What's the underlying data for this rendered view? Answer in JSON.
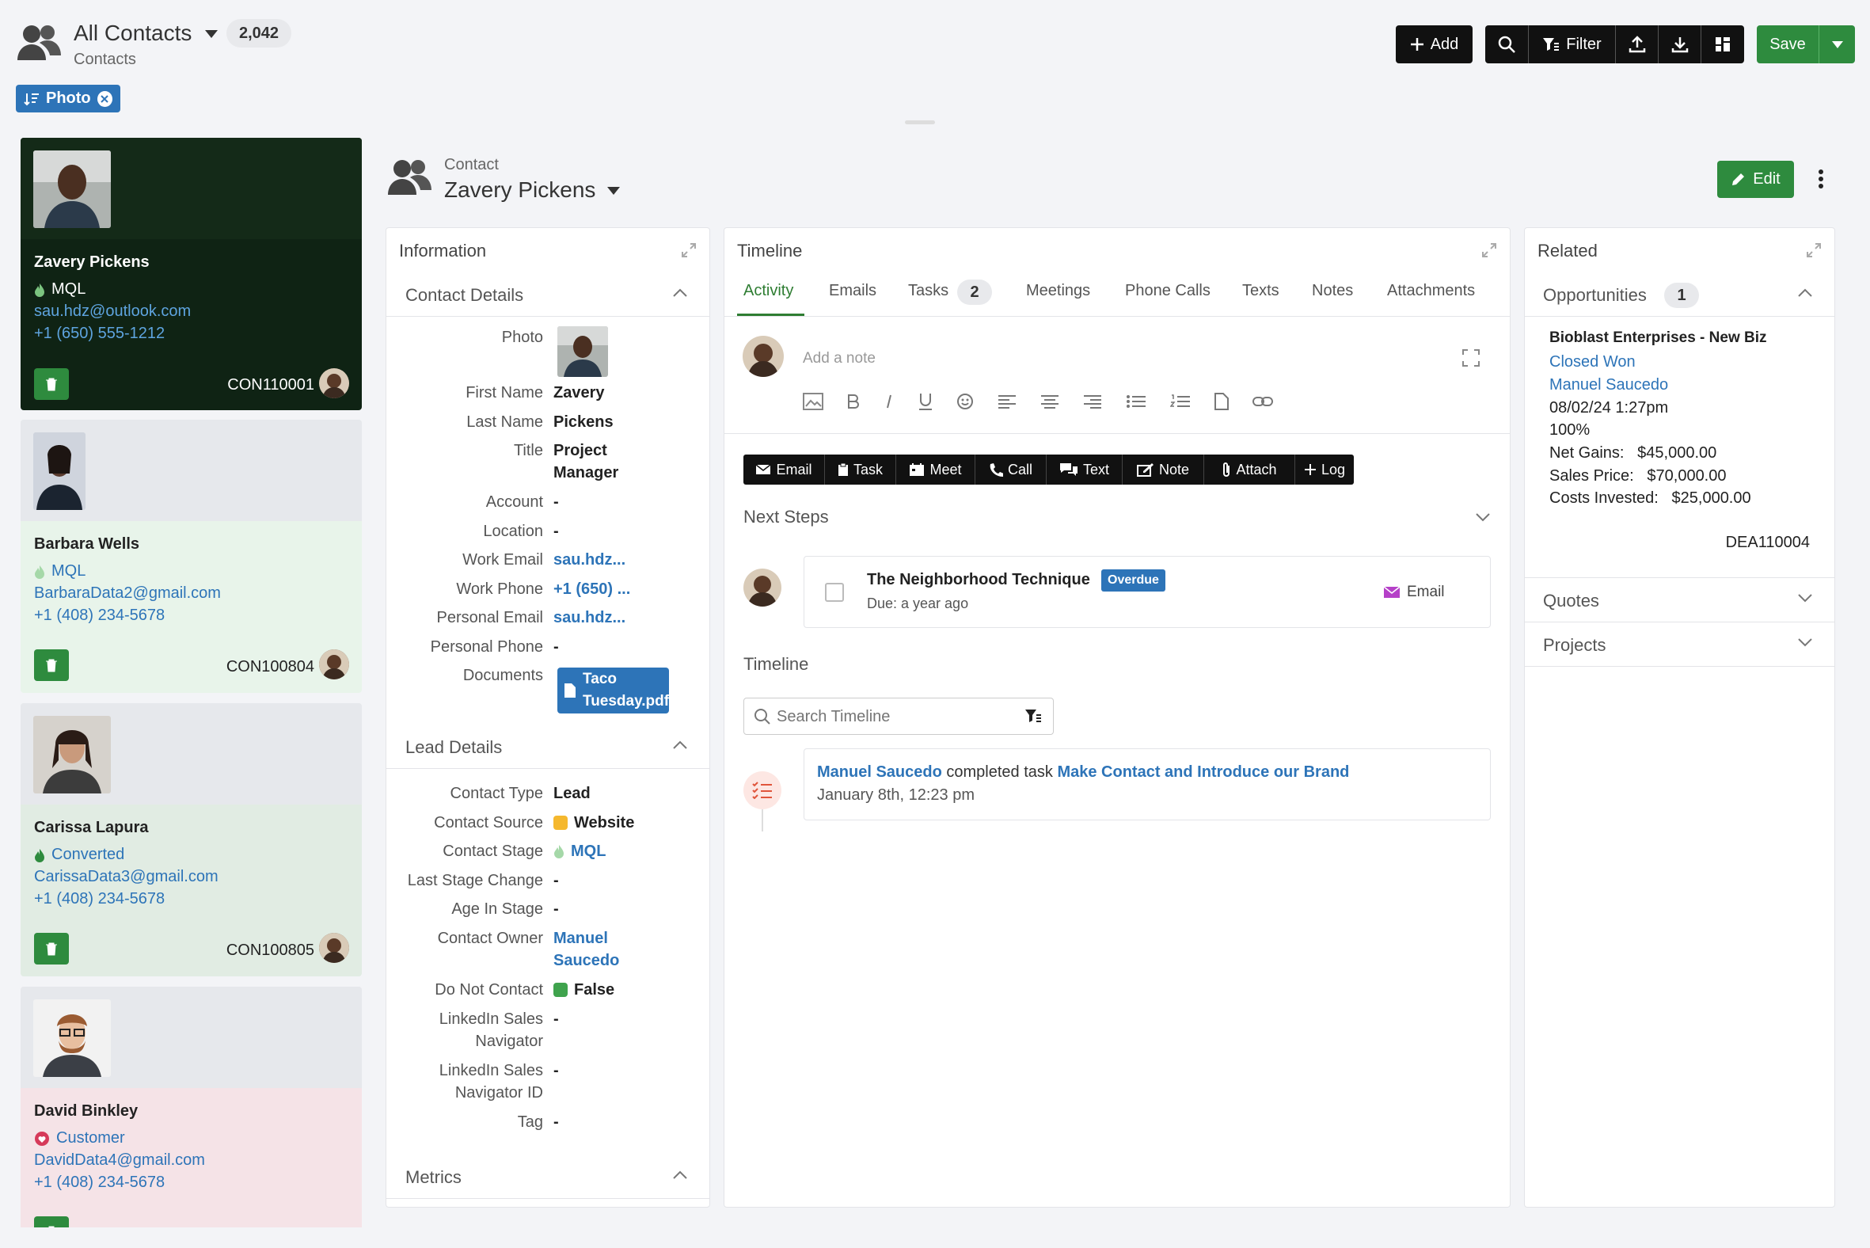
{
  "header": {
    "view_title": "All Contacts",
    "count": "2,042",
    "subtitle": "Contacts",
    "filter_chip": "Photo",
    "add_label": "Add",
    "filter_label": "Filter",
    "save_label": "Save"
  },
  "cards": [
    {
      "name": "Zavery Pickens",
      "stage": "MQL",
      "email": "sau.hdz@outlook.com",
      "phone": "+1 (650) 555-1212",
      "id": "CON110001"
    },
    {
      "name": "Barbara Wells",
      "stage": "MQL",
      "email": "BarbaraData2@gmail.com",
      "phone": "+1 (408) 234-5678",
      "id": "CON100804"
    },
    {
      "name": "Carissa Lapura",
      "stage": "Converted",
      "email": "CarissaData3@gmail.com",
      "phone": "+1 (408) 234-5678",
      "id": "CON100805"
    },
    {
      "name": "David Binkley",
      "stage": "Customer",
      "email": "DavidData4@gmail.com",
      "phone": "+1 (408) 234-5678"
    }
  ],
  "record": {
    "type_label": "Contact",
    "name": "Zavery Pickens",
    "edit_label": "Edit"
  },
  "info": {
    "title": "Information",
    "contact_details": "Contact Details",
    "lead_details": "Lead Details",
    "metrics": "Metrics",
    "fields": [
      {
        "label": "Photo",
        "value": ""
      },
      {
        "label": "First Name",
        "value": "Zavery"
      },
      {
        "label": "Last Name",
        "value": "Pickens"
      },
      {
        "label": "Title",
        "value": "Project Manager"
      },
      {
        "label": "Account",
        "value": "-"
      },
      {
        "label": "Location",
        "value": "-"
      },
      {
        "label": "Work Email",
        "value": "sau.hdz..."
      },
      {
        "label": "Work Phone",
        "value": "+1 (650) ..."
      },
      {
        "label": "Personal Email",
        "value": "sau.hdz..."
      },
      {
        "label": "Personal Phone",
        "value": "-"
      },
      {
        "label": "Documents",
        "value": "Taco Tuesday.pdf"
      }
    ],
    "lead_fields": [
      {
        "label": "Contact Type",
        "value": "Lead"
      },
      {
        "label": "Contact Source",
        "value": "Website"
      },
      {
        "label": "Contact Stage",
        "value": "MQL"
      },
      {
        "label": "Last Stage Change",
        "value": "-"
      },
      {
        "label": "Age In Stage",
        "value": "-"
      },
      {
        "label": "Contact Owner",
        "value": "Manuel Saucedo"
      },
      {
        "label": "Do Not Contact",
        "value": "False"
      },
      {
        "label": "LinkedIn Sales Navigator",
        "value": "-"
      },
      {
        "label": "LinkedIn Sales Navigator ID",
        "value": "-"
      },
      {
        "label": "Tag",
        "value": "-"
      }
    ]
  },
  "timeline": {
    "title": "Timeline",
    "tabs": [
      "Activity",
      "Emails",
      "Tasks",
      "Meetings",
      "Phone Calls",
      "Texts",
      "Notes",
      "Attachments"
    ],
    "tasks_count": "2",
    "note_placeholder": "Add a note",
    "actions": [
      "Email",
      "Task",
      "Meet",
      "Call",
      "Text",
      "Note",
      "Attach",
      "Log"
    ],
    "next_steps": "Next Steps",
    "step_title": "The Neighborhood Technique",
    "step_badge": "Overdue",
    "step_due": "Due: a year ago",
    "step_type": "Email",
    "section": "Timeline",
    "search_placeholder": "Search Timeline",
    "entry_user": "Manuel Saucedo",
    "entry_mid": "completed task",
    "entry_task": "Make Contact and Introduce our Brand",
    "entry_date": "January 8th, 12:23 pm"
  },
  "related": {
    "title": "Related",
    "opps_label": "Opportunities",
    "opps_count": "1",
    "deal_name": "Bioblast Enterprises - New Biz",
    "deal_stage": "Closed Won",
    "deal_owner": "Manuel Saucedo",
    "deal_date": "08/02/24 1:27pm",
    "deal_prob": "100%",
    "net_gains_label": "Net Gains:",
    "net_gains": "$45,000.00",
    "sales_price_label": "Sales Price:",
    "sales_price": "$70,000.00",
    "costs_label": "Costs Invested:",
    "costs": "$25,000.00",
    "deal_id": "DEA110004",
    "quotes": "Quotes",
    "projects": "Projects"
  },
  "colors": {
    "accent": "#2d74b8",
    "green": "#2e8b3e",
    "dark": "#111111",
    "timeline_tab": "#2e7d32"
  }
}
